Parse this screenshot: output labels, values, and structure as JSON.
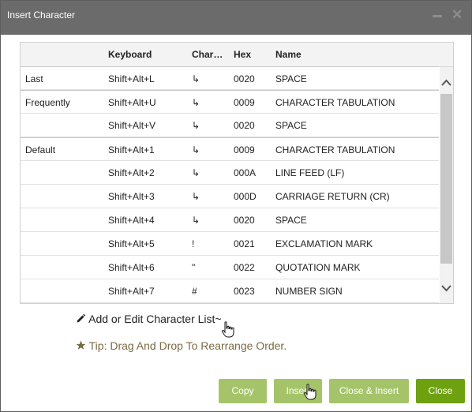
{
  "dialog": {
    "title": "Insert Character"
  },
  "table": {
    "headers": [
      "Keyboard",
      "Char…",
      "Hex",
      "Name"
    ],
    "rows": [
      {
        "group": "Last",
        "key": "Shift+Alt+L",
        "char": "↳",
        "hex": "0020",
        "name": "SPACE"
      },
      {
        "group": "Frequently",
        "key": "Shift+Alt+U",
        "char": "↳",
        "hex": "0009",
        "name": "CHARACTER TABULATION"
      },
      {
        "group": "",
        "key": "Shift+Alt+V",
        "char": "↳",
        "hex": "0020",
        "name": "SPACE"
      },
      {
        "group": "Default",
        "key": "Shift+Alt+1",
        "char": "↳",
        "hex": "0009",
        "name": "CHARACTER TABULATION"
      },
      {
        "group": "",
        "key": "Shift+Alt+2",
        "char": "↳",
        "hex": "000A",
        "name": "LINE FEED (LF)"
      },
      {
        "group": "",
        "key": "Shift+Alt+3",
        "char": "↳",
        "hex": "000D",
        "name": "CARRIAGE RETURN (CR)"
      },
      {
        "group": "",
        "key": "Shift+Alt+4",
        "char": "↳",
        "hex": "0020",
        "name": "SPACE"
      },
      {
        "group": "",
        "key": "Shift+Alt+5",
        "char": "!",
        "hex": "0021",
        "name": "EXCLAMATION MARK"
      },
      {
        "group": "",
        "key": "Shift+Alt+6",
        "char": "\"",
        "hex": "0022",
        "name": "QUOTATION MARK"
      },
      {
        "group": "",
        "key": "Shift+Alt+7",
        "char": "#",
        "hex": "0023",
        "name": "NUMBER SIGN"
      }
    ]
  },
  "actions": {
    "edit_link": "Add or Edit Character List~",
    "tip": "Tip: Drag And Drop To Rearrange Order."
  },
  "buttons": {
    "copy": "Copy",
    "insert": "Insert",
    "close_insert": "Close & Insert",
    "close": "Close"
  },
  "icons": {
    "edit": "pencil-icon",
    "tip": "star-icon"
  },
  "colors": {
    "primary": "#6da110",
    "secondary": "#a5c46a",
    "tip": "#7a6a42",
    "title_bar": "#6b6b6b"
  }
}
